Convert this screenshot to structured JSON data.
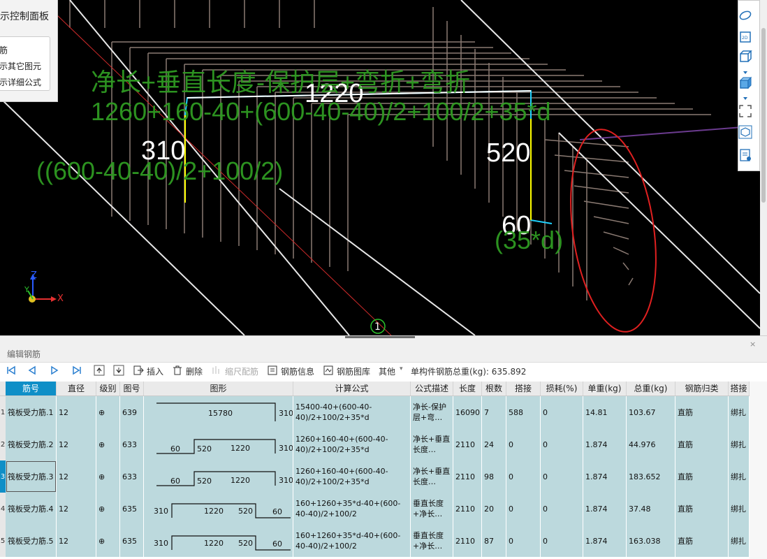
{
  "viewport": {
    "dims": {
      "d1220": "1220",
      "d310": "310",
      "d520": "520",
      "d60": "60"
    },
    "formula_line1": "净长+垂直长度-保护层+弯折+弯折",
    "formula_line2": "1260+160-40+(600-40-40)/2+100/2+35*d",
    "formula_left": "((600-40-40)/2+100/2)",
    "formula_right": "(35*d)",
    "axis": {
      "x": "X",
      "y": "Y",
      "z": "Z"
    },
    "axis_marker": "1"
  },
  "control_panel": {
    "title": "示控制面板",
    "items": [
      "筋",
      "示其它图元",
      "示详细公式"
    ]
  },
  "panel": {
    "title": "编辑钢筋",
    "close": "×"
  },
  "toolbar": {
    "insert": "插入",
    "delete": "删除",
    "scale": "缩尺配筋",
    "info": "钢筋信息",
    "library": "钢筋图库",
    "other": "其他",
    "total_label": "单构件钢筋总重(kg): 635.892"
  },
  "table": {
    "headers": [
      "筋号",
      "直径(mm)",
      "级别",
      "图号",
      "图形",
      "计算公式",
      "公式描述",
      "长度",
      "根数",
      "搭接",
      "损耗(%)",
      "单重(kg)",
      "总重(kg)",
      "钢筋归类",
      "搭接"
    ],
    "rows": [
      {
        "num": "1",
        "name": "筏板受力筋.1",
        "dia": "12",
        "grade": "⊕",
        "fig": "639",
        "shape": {
          "a": "15780",
          "b": "310"
        },
        "formula": "15400-40+(600-40-40)/2+100/2+35*d",
        "desc": "净长-保护层+弯…",
        "len": "16090",
        "count": "7",
        "lap": "588",
        "loss": "0",
        "unit": "14.81",
        "total": "103.67",
        "cat": "直筋",
        "lapt": "绑扎"
      },
      {
        "num": "2",
        "name": "筏板受力筋.2",
        "dia": "12",
        "grade": "⊕",
        "fig": "633",
        "shape": {
          "a": "60",
          "b": "520",
          "c": "1220",
          "d": "310"
        },
        "formula": "1260+160-40+(600-40-40)/2+100/2+35*d",
        "desc": "净长+垂直长度…",
        "len": "2110",
        "count": "24",
        "lap": "0",
        "loss": "0",
        "unit": "1.874",
        "total": "44.976",
        "cat": "直筋",
        "lapt": "绑扎"
      },
      {
        "num": "3",
        "name": "筏板受力筋.3",
        "dia": "12",
        "grade": "⊕",
        "fig": "633",
        "shape": {
          "a": "60",
          "b": "520",
          "c": "1220",
          "d": "310"
        },
        "formula": "1260+160-40+(600-40-40)/2+100/2+35*d",
        "desc": "净长+垂直长度…",
        "len": "2110",
        "count": "98",
        "lap": "0",
        "loss": "0",
        "unit": "1.874",
        "total": "183.652",
        "cat": "直筋",
        "lapt": "绑扎"
      },
      {
        "num": "4",
        "name": "筏板受力筋.4",
        "dia": "12",
        "grade": "⊕",
        "fig": "635",
        "shape": {
          "a": "310",
          "b": "1220",
          "c": "520",
          "d": "60"
        },
        "formula": "160+1260+35*d-40+(600-40-40)/2+100/2",
        "desc": "垂直长度+净长…",
        "len": "2110",
        "count": "20",
        "lap": "0",
        "loss": "0",
        "unit": "1.874",
        "total": "37.48",
        "cat": "直筋",
        "lapt": "绑扎"
      },
      {
        "num": "5",
        "name": "筏板受力筋.5",
        "dia": "12",
        "grade": "⊕",
        "fig": "635",
        "shape": {
          "a": "310",
          "b": "1220",
          "c": "520",
          "d": "60"
        },
        "formula": "160+1260+35*d-40+(600-40-40)/2+100/2",
        "desc": "垂直长度+净长…",
        "len": "2110",
        "count": "87",
        "lap": "0",
        "loss": "0",
        "unit": "1.874",
        "total": "163.038",
        "cat": "直筋",
        "lapt": "绑扎"
      }
    ]
  }
}
